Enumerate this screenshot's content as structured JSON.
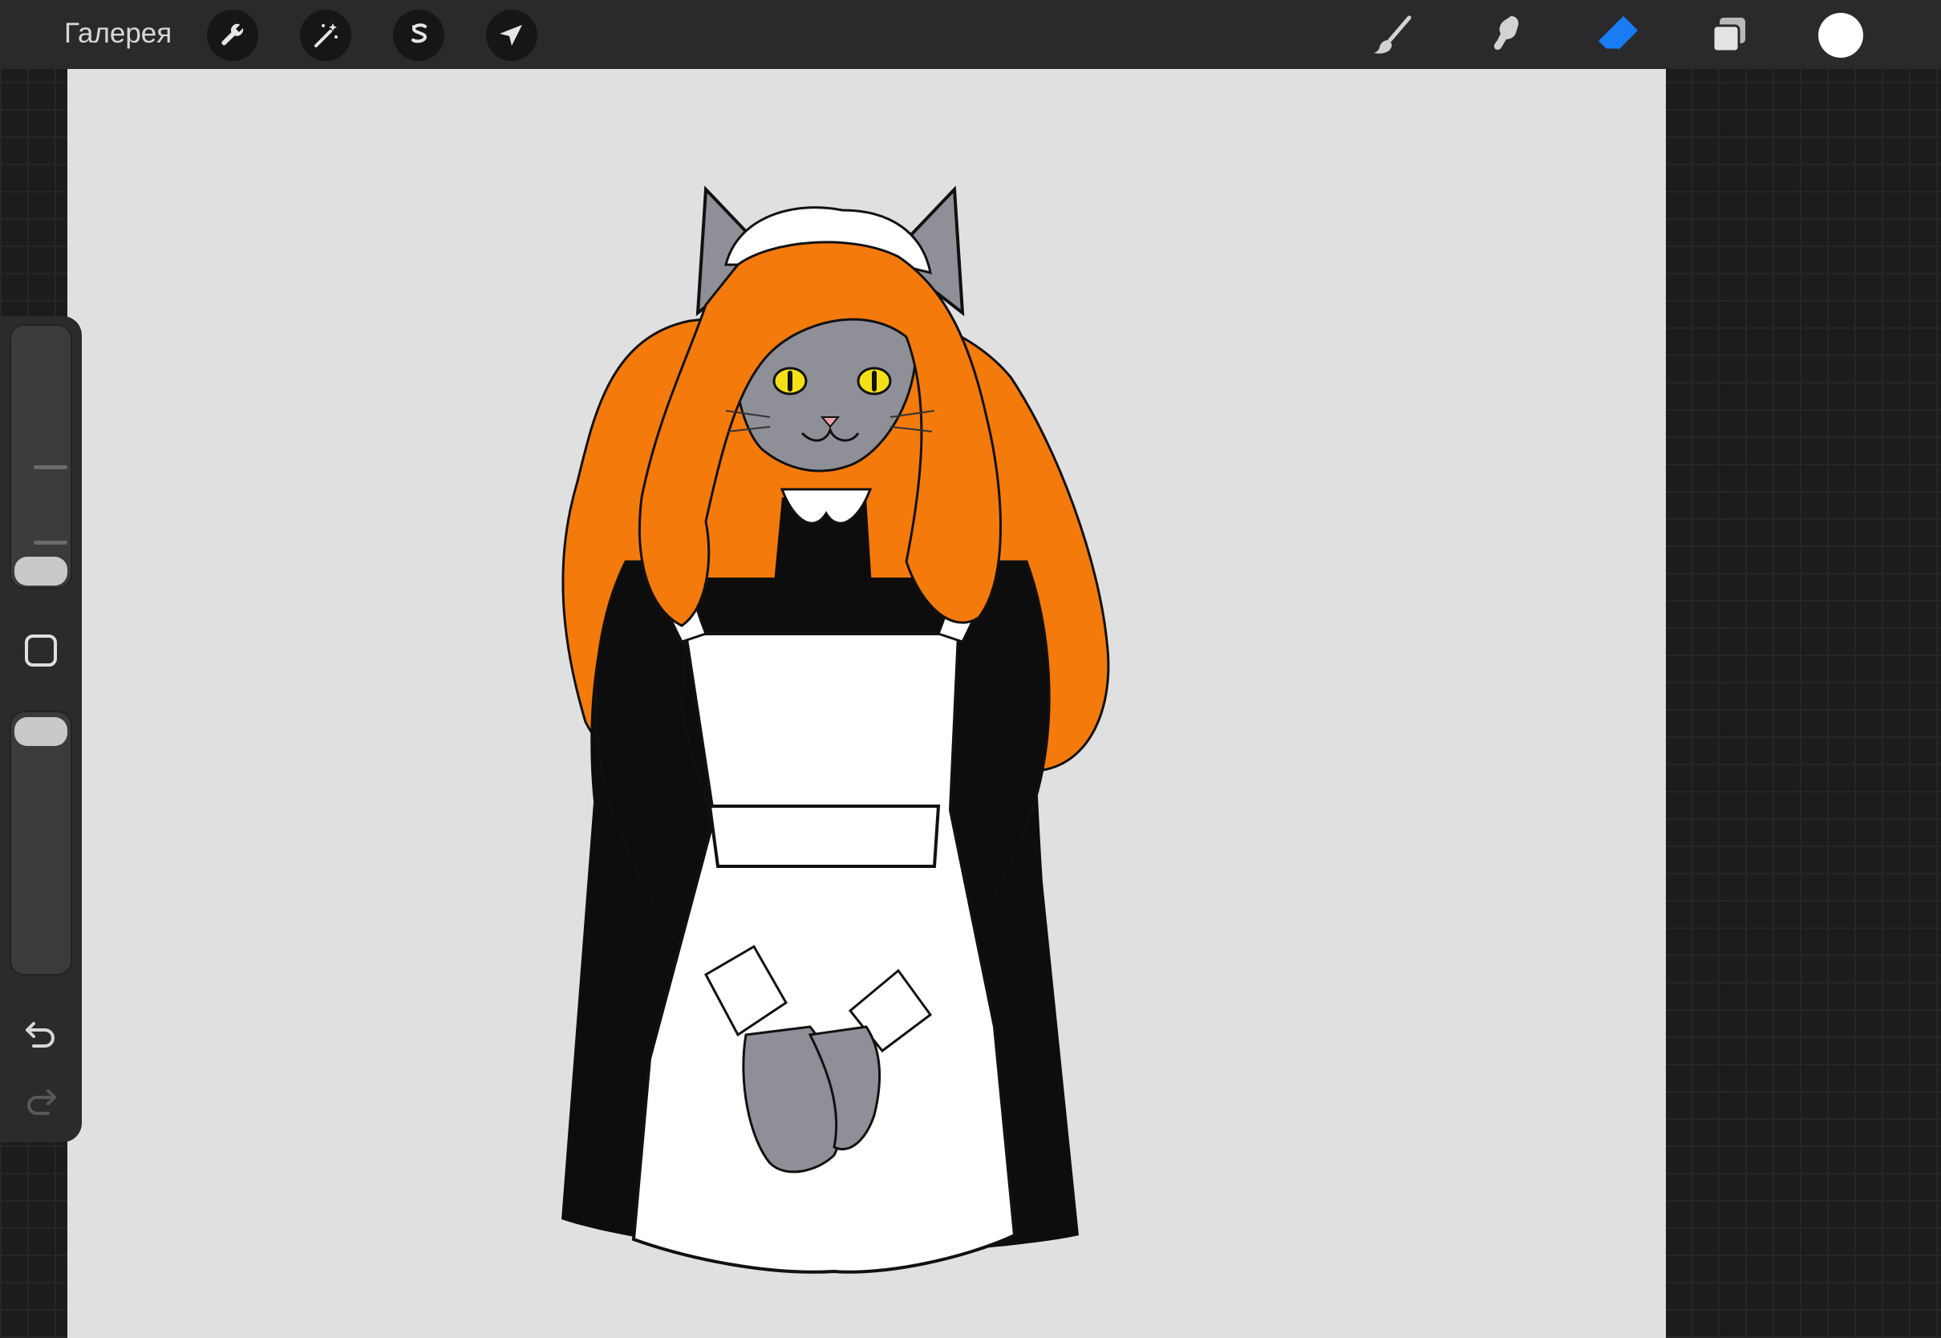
{
  "topbar": {
    "gallery_label": "Галерея",
    "tools_left": [
      {
        "icon": "wrench-icon"
      },
      {
        "icon": "magic-wand-icon"
      },
      {
        "icon": "selection-icon"
      },
      {
        "icon": "transform-arrow-icon"
      }
    ],
    "tools_right": [
      {
        "icon": "brush-icon"
      },
      {
        "icon": "smudge-icon"
      },
      {
        "icon": "eraser-icon",
        "active": true
      },
      {
        "icon": "layers-icon"
      }
    ],
    "current_color": "#ffffff",
    "active_color": "#1a7cf5"
  },
  "sidebar": {
    "brush_size": 0.08,
    "opacity": 1.0,
    "controls": [
      "modify-square-icon",
      "undo-icon",
      "redo-icon"
    ]
  },
  "canvas": {
    "background": "#e0e0e0",
    "hair_color": "#f47a0c",
    "fur_color": "#8f8f97",
    "eye_color": "#f2e116"
  }
}
